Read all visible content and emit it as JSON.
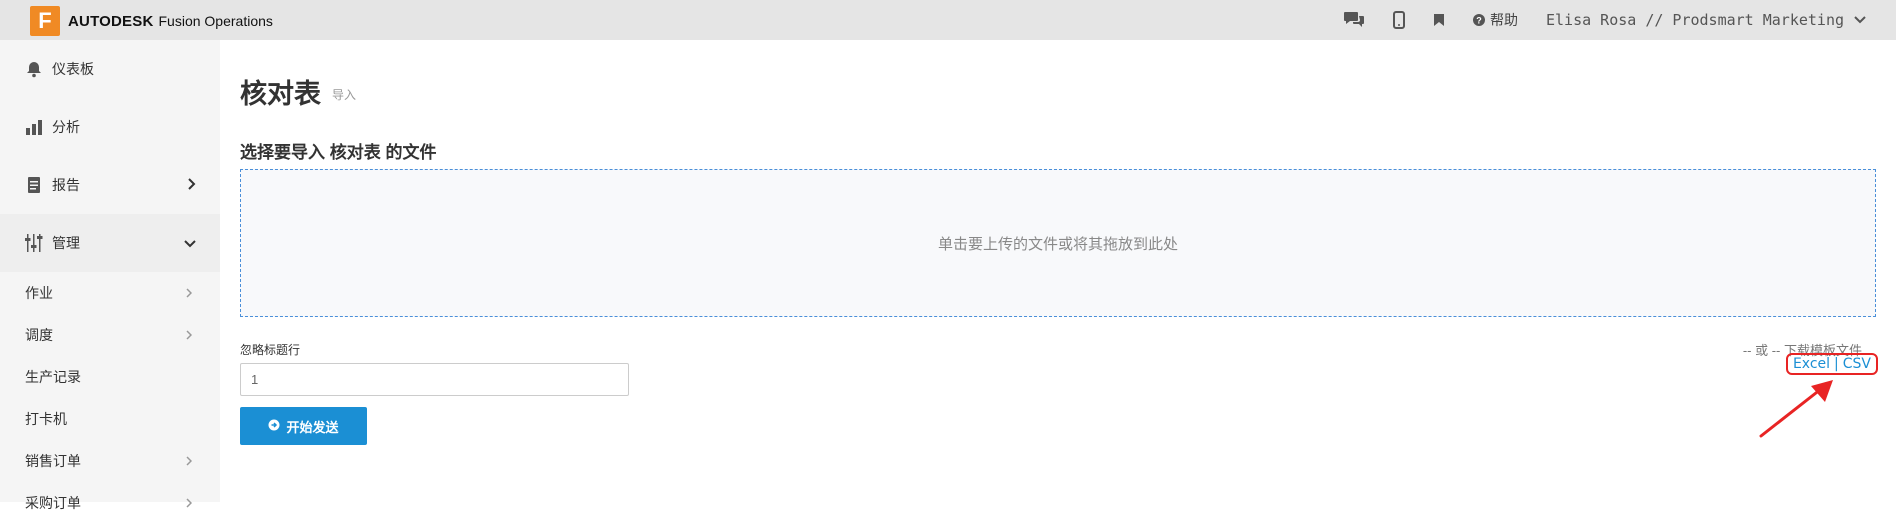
{
  "topbar": {
    "logo_letter": "F",
    "brand": "AUTODESK",
    "product": "Fusion Operations",
    "help_label": "帮助",
    "user_label": "Elisa Rosa // Prodsmart Marketing",
    "icons": [
      "chat-icon",
      "mobile-icon",
      "bookmark-icon",
      "question-circle-icon",
      "chevron-down-icon"
    ]
  },
  "sidebar": {
    "main_items": [
      {
        "label": "仪表板",
        "icon": "bell-icon"
      },
      {
        "label": "分析",
        "icon": "bar-chart-icon"
      },
      {
        "label": "报告",
        "icon": "document-icon"
      },
      {
        "label": "管理",
        "icon": "sliders-icon"
      }
    ],
    "sub_items": [
      {
        "label": "作业"
      },
      {
        "label": "调度"
      },
      {
        "label": "生产记录"
      },
      {
        "label": "打卡机"
      },
      {
        "label": "销售订单"
      },
      {
        "label": "采购订单"
      }
    ]
  },
  "main": {
    "title": "核对表",
    "subtitle": "导入",
    "section_title": "选择要导入 核对表 的文件",
    "dropzone_text": "单击要上传的文件或将其拖放到此处",
    "ignore_label": "忽略标题行",
    "ignore_value": "1",
    "send_label": "开始发送",
    "or_text": "-- 或 -- 下载模板文件",
    "link_excel": "Excel",
    "link_sep": "|",
    "link_csv": "CSV"
  },
  "colors": {
    "accent": "#1b8fd4",
    "logo": "#f08a24",
    "annotation": "#e82424"
  }
}
